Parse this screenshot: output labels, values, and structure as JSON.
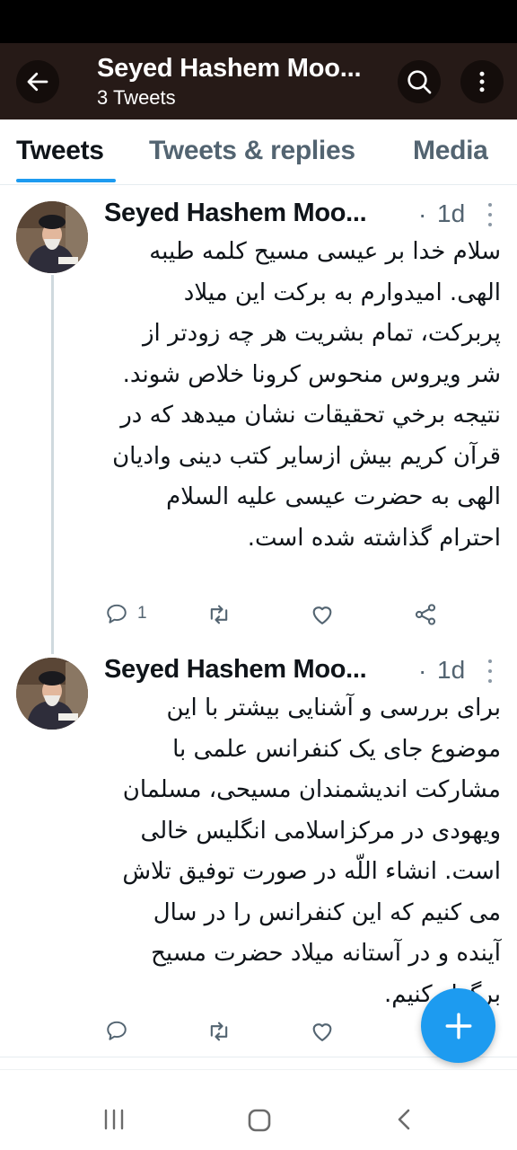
{
  "header": {
    "title": "Seyed Hashem Moo...",
    "subtitle": "3 Tweets",
    "back_icon": "arrow-left-icon",
    "search_icon": "search-icon",
    "more_icon": "more-vertical-icon"
  },
  "tabs": [
    {
      "label": "Tweets",
      "active": true
    },
    {
      "label": "Tweets & replies",
      "active": false
    },
    {
      "label": "Media",
      "active": false
    }
  ],
  "tweets": [
    {
      "author": "Seyed Hashem Moo...",
      "separator": "·",
      "time": "1d",
      "text": "سلام خدا بر عیسی مسیح کلمه طیبه الهی. امیدوارم به برکت این میلاد پربرکت، تمام بشریت هر چه زودتر از شر ویروس منحوس کرونا خلاص شوند. نتیجه برخي تحقيقات نشان ميدهد که در قرآن کریم بیش ازسایر کتب دینی وادیان الهی به حضرت عیسی علیه السلام احترام گذاشته شده است.",
      "reply_count": "1",
      "retweet_count": "",
      "like_count": ""
    },
    {
      "author": "Seyed Hashem Moo...",
      "separator": "·",
      "time": "1d",
      "text": "برای بررسی و آشنایی بیشتر با این موضوع  جای یک کنفرانس علمی با مشارکت اندیشمندان مسیحی، مسلمان ویهودی در مرکزاسلامی انگلیس خالی است. انشاء اللّه در صورت توفیق تلاش می کنیم که این کنفرانس را در سال آینده و در آستانه میلاد حضرت مسیح برگزار کنیم.",
      "reply_count": "",
      "retweet_count": "",
      "like_count": ""
    }
  ],
  "fab": {
    "icon": "plus-icon",
    "label": "+"
  },
  "navigation": {
    "recents_icon": "recent-apps-icon",
    "home_icon": "home-icon",
    "back_icon": "back-chevron-icon"
  },
  "colors": {
    "accent": "#1d9bf0",
    "header_bg": "#261a17",
    "muted_text": "#536471"
  }
}
